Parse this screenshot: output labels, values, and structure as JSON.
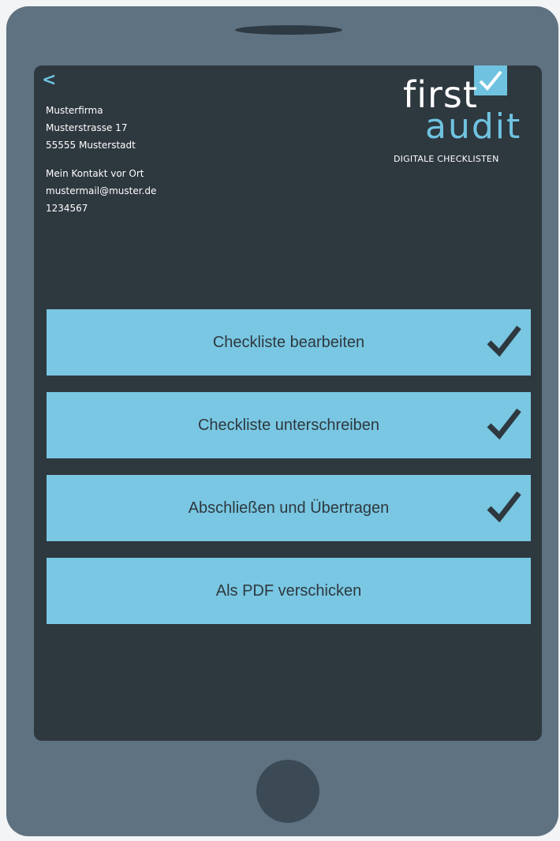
{
  "nav": {
    "back_glyph": "<"
  },
  "company": {
    "name": "Musterfirma",
    "street": "Musterstrasse 17",
    "city": "55555 Musterstadt",
    "contact_heading": "Mein Kontakt vor Ort",
    "email": "mustermail@muster.de",
    "phone": "1234567"
  },
  "logo": {
    "word1": "first",
    "word2": "audit",
    "tagline": "DIGITALE CHECKLISTEN"
  },
  "menu": {
    "items": [
      {
        "label": "Checkliste bearbeiten",
        "completed": true
      },
      {
        "label": "Checkliste unterschreiben",
        "completed": true
      },
      {
        "label": "Abschließen und Übertragen",
        "completed": true
      },
      {
        "label": "Als PDF verschicken",
        "completed": false
      }
    ]
  },
  "colors": {
    "device_frame": "#5f7282",
    "screen_bg": "#2e383f",
    "accent": "#79c7e2",
    "button_text": "#2e383f"
  }
}
